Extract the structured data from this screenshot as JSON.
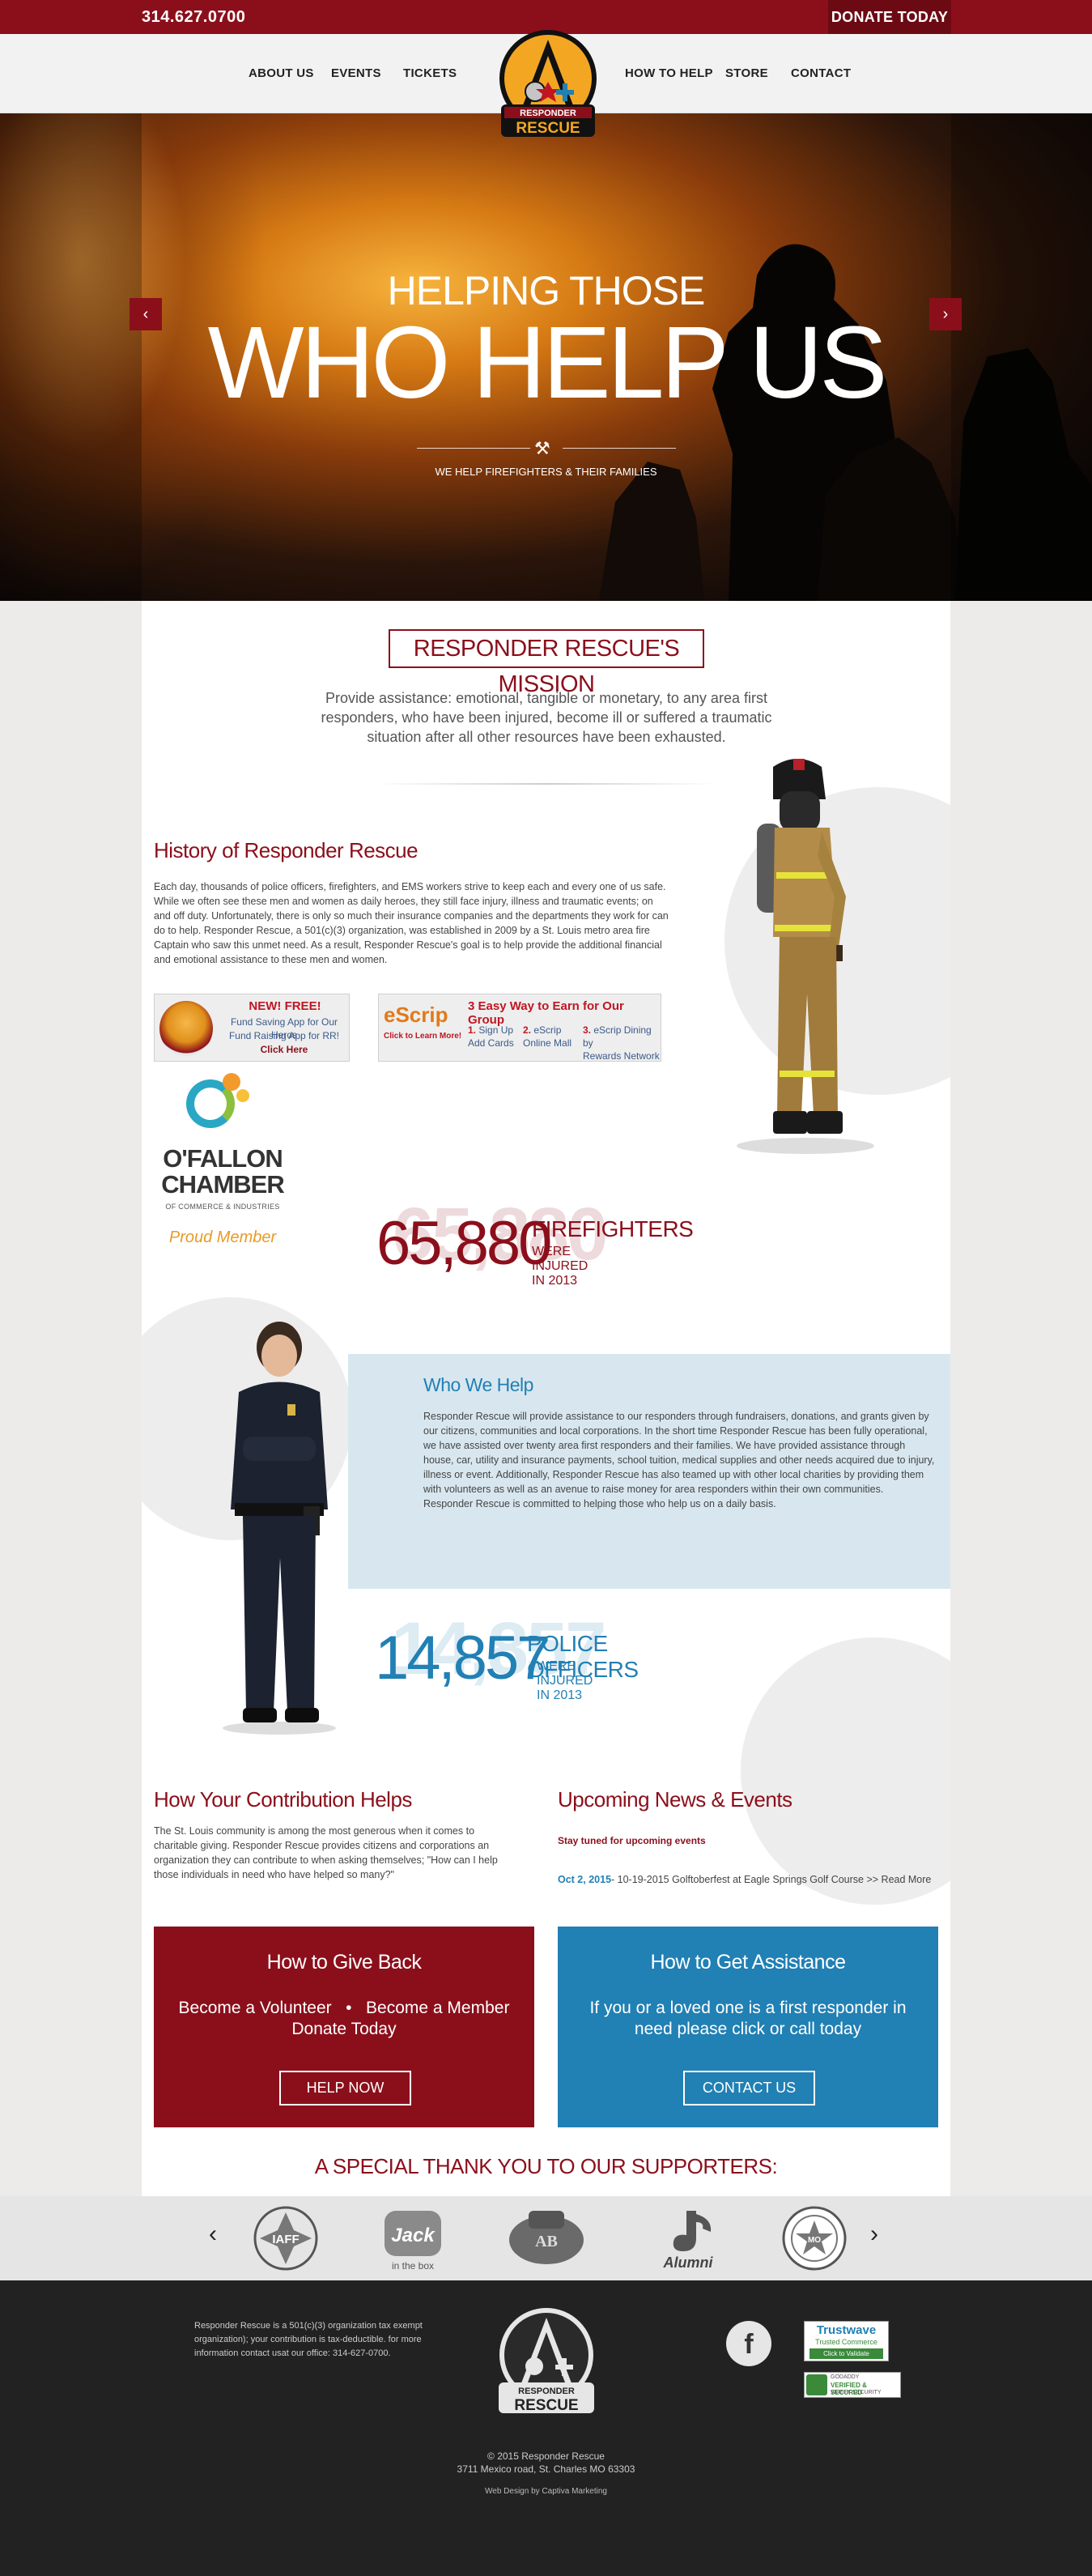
{
  "topbar": {
    "phone": "314.627.0700",
    "donate": "DONATE TODAY"
  },
  "nav": {
    "items": [
      "ABOUT US",
      "EVENTS",
      "TICKETS",
      "HOW TO HELP",
      "STORE",
      "CONTACT"
    ],
    "logo_text_1": "RESPONDER",
    "logo_text_2": "RESCUE"
  },
  "hero": {
    "subtitle": "HELPING THOSE",
    "title": "WHO HELP US",
    "tagline": "WE HELP FIREFIGHTERS & THEIR FAMILIES",
    "prev": "‹",
    "next": "›"
  },
  "mission": {
    "heading": "RESPONDER RESCUE'S MISSION",
    "text": "Provide assistance: emotional, tangible or monetary, to any area first responders, who have been injured, become ill or suffered a traumatic situation after all other resources have been exhausted."
  },
  "history": {
    "heading": "History of Responder Rescue",
    "text": "Each day, thousands of police officers, firefighters, and EMS workers strive to keep each and every one of us safe. While we often see these men and women as daily heroes, they still face injury, illness and traumatic events; on and off duty. Unfortunately, there is only so much their insurance companies and the departments they work for can do to help. Responder Rescue, a 501(c)(3) organization, was established in 2009 by a St. Louis metro area fire Captain who saw this unmet need. As a result, Responder Rescue's goal is to help provide the additional financial and emotional assistance to these men and women."
  },
  "promo_app": {
    "title": "NEW! FREE!",
    "line1": "Fund Saving App for Our Heros",
    "line2": "Fund Raising App for RR!",
    "cta": "Click Here"
  },
  "promo_scrip": {
    "brand": "eScrip",
    "brand_cta": "Click to Learn More!",
    "title": "3 Easy Way to Earn for Our Group",
    "steps": [
      {
        "n": "1.",
        "a": "Sign Up",
        "b": "Add Cards"
      },
      {
        "n": "2.",
        "a": "eScrip",
        "b": "Online Mall"
      },
      {
        "n": "3.",
        "a": "eScrip Dining by",
        "b": "Rewards Network"
      }
    ]
  },
  "chamber": {
    "name1": "O'FALLON",
    "name2": "CHAMBER",
    "sub": "OF COMMERCE & INDUSTRIES",
    "member": "Proud Member"
  },
  "stat_fire": {
    "number": "65,880",
    "label1": "FIREFIGHTERS",
    "label2": "WERE INJURED IN 2013",
    "color": "#8b0f1b"
  },
  "who": {
    "heading": "Who We Help",
    "text": "Responder Rescue will provide assistance to our responders through fundraisers, donations, and grants given by our citizens, communities and local corporations. In the short time Responder Rescue has been fully operational, we have assisted over twenty area first responders and their families. We have provided assistance through house, car, utility and insurance payments, school tuition, medical supplies and other needs acquired due to injury, illness or event. Additionally, Responder Rescue has also teamed up with other local charities by providing them with volunteers as well as an avenue to raise money for area responders within their own communities. Responder Rescue is committed to helping those who help us on a daily basis."
  },
  "stat_police": {
    "number": "14,857",
    "label1": "POLICE OFFICERS",
    "label2": "WERE INJURED IN 2013",
    "color": "#2180b4"
  },
  "contribution": {
    "heading": "How Your Contribution Helps",
    "text": "The St. Louis community is among the most generous when it comes to charitable giving. Responder Rescue provides citizens and corporations an organization they can contribute to when asking themselves; \"How can I help those individuals in need who have helped so many?\""
  },
  "news": {
    "heading": "Upcoming News & Events",
    "subheading": "Stay tuned for upcoming events",
    "date": "Oct 2, 2015",
    "item": "- 10-19-2015 Golftoberfest at Eagle Springs Golf Course >> Read More"
  },
  "give_back": {
    "heading": "How to Give Back",
    "line1a": "Become a Volunteer",
    "line1b": "Become a Member",
    "line2": "Donate Today",
    "button": "HELP NOW",
    "color": "#8b0f1b"
  },
  "assistance": {
    "heading": "How to Get Assistance",
    "text": "If you or a loved one is a first responder in need please click or call today",
    "button": "CONTACT US",
    "color": "#2180b4"
  },
  "supporters": {
    "heading": "A SPECIAL THANK YOU TO OUR SUPPORTERS:",
    "prev": "‹",
    "next": "›",
    "logos": [
      {
        "name": "iaff-logo",
        "text": "IAFF"
      },
      {
        "name": "jack-in-the-box-logo",
        "text": "Jack",
        "sub": "in the box"
      },
      {
        "name": "anheuser-busch-logo",
        "text": "AB"
      },
      {
        "name": "blues-alumni-logo",
        "text": "Alumni"
      },
      {
        "name": "missouri-seal-logo",
        "text": "MO"
      }
    ]
  },
  "footer": {
    "info": "Responder Rescue is a 501(c)(3) organization tax exempt organization); your contribution is tax-deductible. for more information contact usat our office: 314-627-0700.",
    "logo_text_1": "RESPONDER",
    "logo_text_2": "RESCUE",
    "facebook": "f",
    "trustwave_1": "Trustwave",
    "trustwave_2": "Trusted Commerce",
    "trustwave_3": "Click to Validate",
    "secure_1": "GODADDY",
    "secure_2": "VERIFIED & SECURED",
    "secure_3": "VERIFY SECURITY",
    "copyright": "© 2015 Responder Rescue",
    "address": "3711 Mexico road, St. Charles MO 63303",
    "credit": "Web Design by Captiva Marketing"
  }
}
